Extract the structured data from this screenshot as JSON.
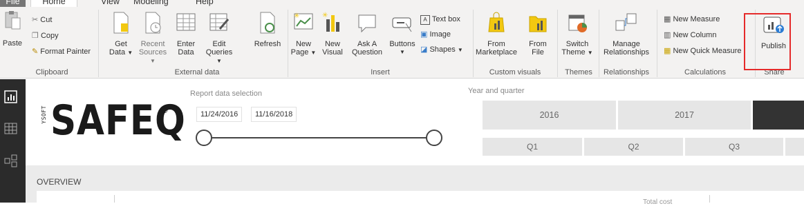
{
  "menu": {
    "file": "File",
    "tabs": [
      "Home",
      "View",
      "Modeling",
      "Help"
    ]
  },
  "clipboard": {
    "paste": "Paste",
    "cut": "Cut",
    "copy": "Copy",
    "format_painter": "Format Painter",
    "group": "Clipboard"
  },
  "external_data": {
    "get_data": [
      "Get",
      "Data"
    ],
    "recent_sources": [
      "Recent",
      "Sources"
    ],
    "enter_data": [
      "Enter",
      "Data"
    ],
    "edit_queries": [
      "Edit",
      "Queries"
    ],
    "refresh": "Refresh",
    "group": "External data"
  },
  "insert": {
    "new_page": [
      "New",
      "Page"
    ],
    "new_visual": [
      "New",
      "Visual"
    ],
    "ask_question": [
      "Ask A",
      "Question"
    ],
    "buttons": "Buttons",
    "text_box": "Text box",
    "image": "Image",
    "shapes": "Shapes",
    "group": "Insert"
  },
  "custom_visuals": {
    "from_marketplace": [
      "From",
      "Marketplace"
    ],
    "from_file": [
      "From",
      "File"
    ],
    "group": "Custom visuals"
  },
  "themes": {
    "switch_theme": [
      "Switch",
      "Theme"
    ],
    "group": "Themes"
  },
  "relationships": {
    "manage": [
      "Manage",
      "Relationships"
    ],
    "group": "Relationships"
  },
  "calculations": {
    "new_measure": "New Measure",
    "new_column": "New Column",
    "new_quick_measure": "New Quick Measure",
    "group": "Calculations"
  },
  "share": {
    "publish": "Publish",
    "group": "Share"
  },
  "report": {
    "logo_side": "YSOFT",
    "logo": "SAFEQ",
    "reg": "®",
    "selection_title": "Report data selection",
    "date_start": "11/24/2016",
    "date_end": "11/16/2018",
    "yq_title": "Year and quarter",
    "years": [
      "2016",
      "2017"
    ],
    "quarters": [
      "Q1",
      "Q2",
      "Q3"
    ],
    "overview": "OVERVIEW",
    "card_label": "Total cost"
  },
  "colors": {
    "highlight": "#e52a2a",
    "accent": "#f2c811"
  }
}
